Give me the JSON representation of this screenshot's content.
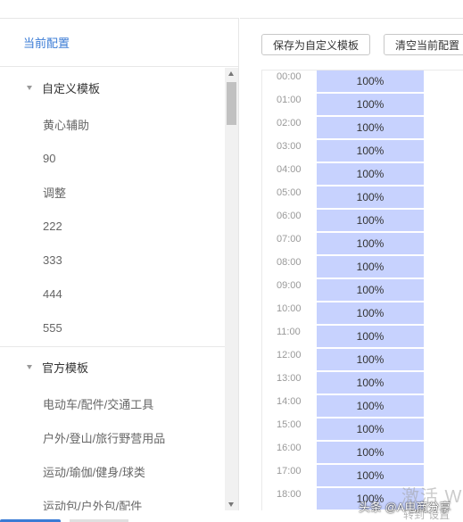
{
  "left_panel": {
    "title": "当前配置",
    "groups": [
      {
        "title": "自定义模板",
        "items": [
          "黄心辅助",
          "90",
          "调整",
          "222",
          "333",
          "444",
          "555"
        ]
      },
      {
        "title": "官方模板",
        "items": [
          "电动车/配件/交通工具",
          "户外/登山/旅行野营用品",
          "运动/瑜伽/健身/球类",
          "运动包/户外包/配件"
        ]
      }
    ]
  },
  "toolbar": {
    "save_template": "保存为自定义模板",
    "clear_config": "清空当前配置"
  },
  "schedule": {
    "rows": [
      {
        "time": "00:00",
        "value": "100%"
      },
      {
        "time": "01:00",
        "value": "100%"
      },
      {
        "time": "02:00",
        "value": "100%"
      },
      {
        "time": "03:00",
        "value": "100%"
      },
      {
        "time": "04:00",
        "value": "100%"
      },
      {
        "time": "05:00",
        "value": "100%"
      },
      {
        "time": "06:00",
        "value": "100%"
      },
      {
        "time": "07:00",
        "value": "100%"
      },
      {
        "time": "08:00",
        "value": "100%"
      },
      {
        "time": "09:00",
        "value": "100%"
      },
      {
        "time": "10:00",
        "value": "100%"
      },
      {
        "time": "11:00",
        "value": "100%"
      },
      {
        "time": "12:00",
        "value": "100%"
      },
      {
        "time": "13:00",
        "value": "100%"
      },
      {
        "time": "14:00",
        "value": "100%"
      },
      {
        "time": "15:00",
        "value": "100%"
      },
      {
        "time": "16:00",
        "value": "100%"
      },
      {
        "time": "17:00",
        "value": "100%"
      },
      {
        "time": "18:00",
        "value": "100%"
      }
    ]
  },
  "watermark": {
    "activate": "激活 W",
    "goto_settings": "转到\"设置",
    "brand": "头条 @A电商分享"
  },
  "colors": {
    "accent": "#3a7bd5",
    "bar_fill": "#c7d2fe"
  }
}
